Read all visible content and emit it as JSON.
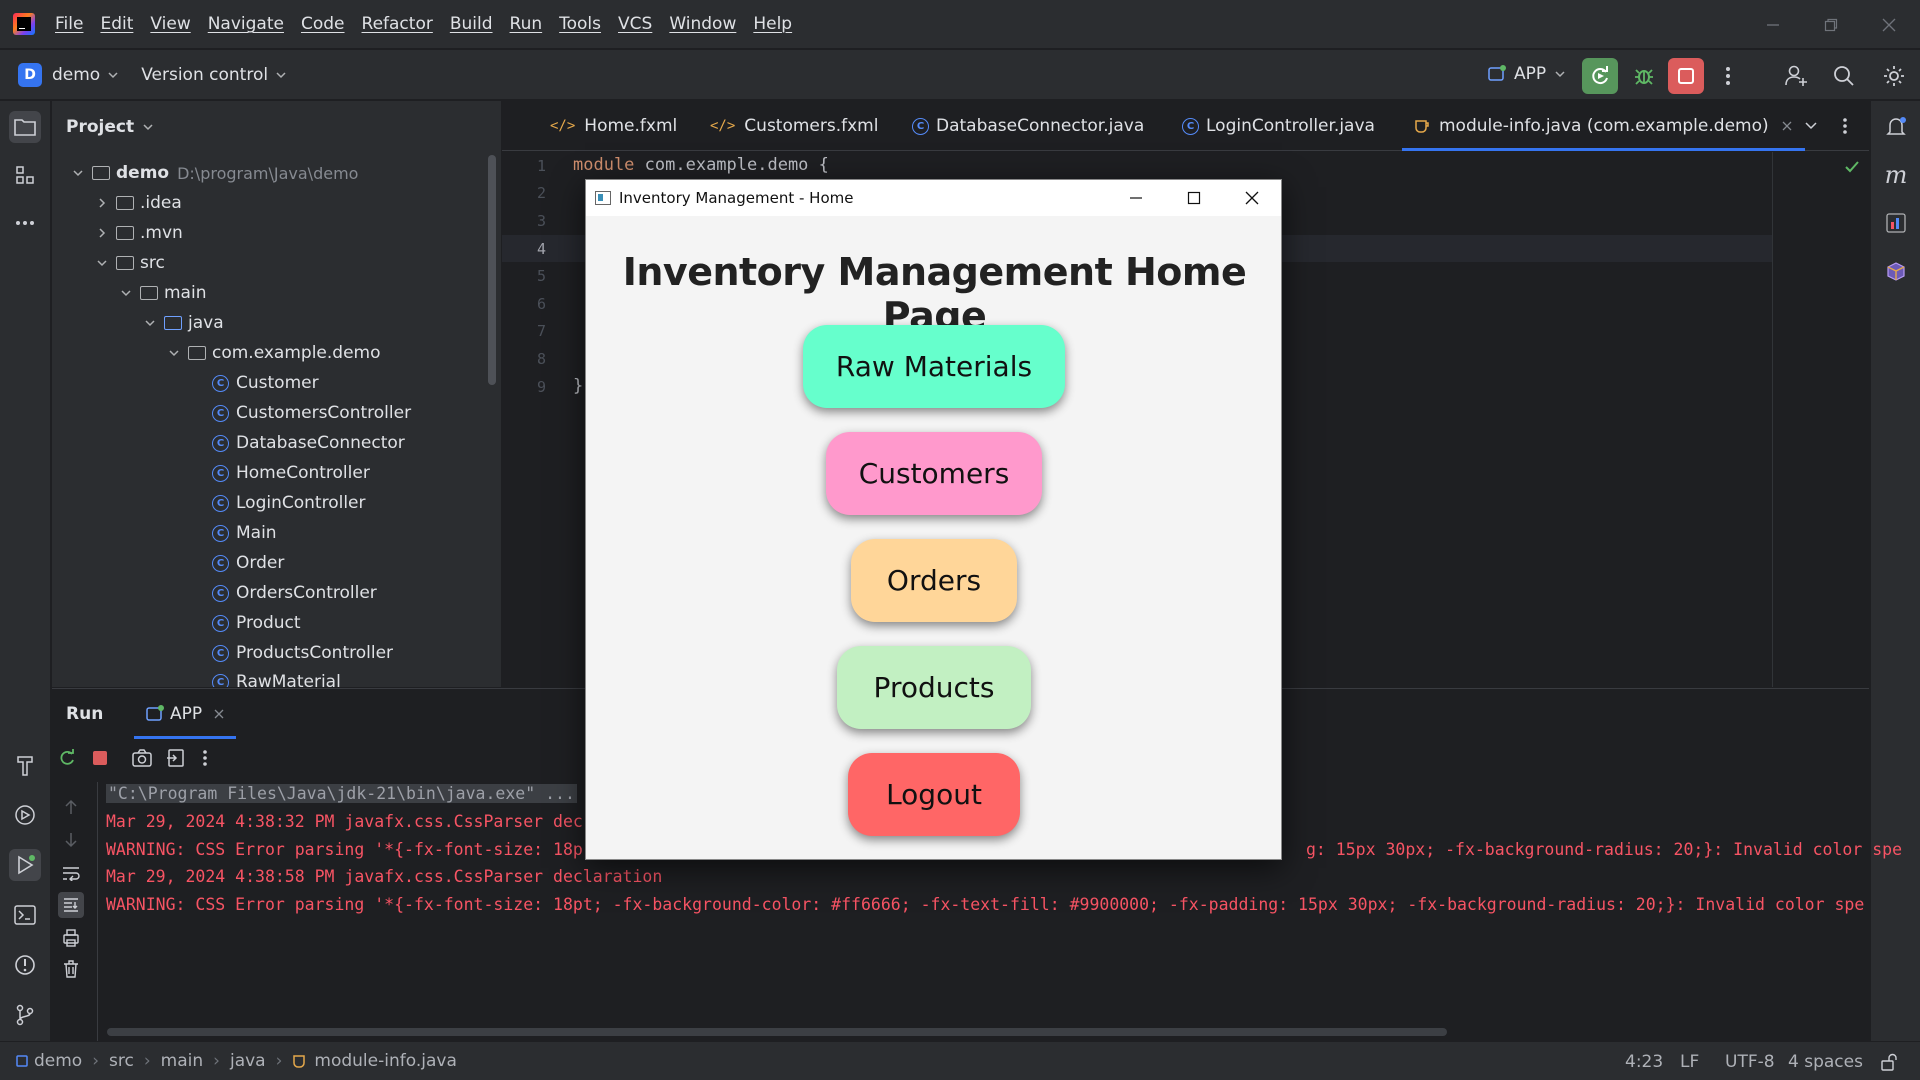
{
  "menu": [
    "File",
    "Edit",
    "View",
    "Navigate",
    "Code",
    "Refactor",
    "Build",
    "Run",
    "Tools",
    "VCS",
    "Window",
    "Help"
  ],
  "toolbar": {
    "project_badge": "D",
    "project_name": "demo",
    "version_control": "Version control",
    "run_config": "APP"
  },
  "project_panel": {
    "title": "Project",
    "root_name": "demo",
    "root_path": "D:\\program\\Java\\demo",
    "folders": [
      ".idea",
      ".mvn",
      "src",
      "main",
      "java",
      "com.example.demo"
    ],
    "classes": [
      "Customer",
      "CustomersController",
      "DatabaseConnector",
      "HomeController",
      "LoginController",
      "Main",
      "Order",
      "OrdersController",
      "Product",
      "ProductsController",
      "RawMaterial"
    ]
  },
  "editor": {
    "tabs": [
      "Home.fxml",
      "Customers.fxml",
      "DatabaseConnector.java",
      "LoginController.java",
      "module-info.java (com.example.demo)"
    ],
    "line_numbers": [
      "1",
      "2",
      "3",
      "4",
      "5",
      "6",
      "7",
      "8",
      "9"
    ],
    "code_line1_kw": "module",
    "code_line1_rest": " com.example.demo {",
    "code_line9": "}"
  },
  "run_panel": {
    "title": "Run",
    "tab": "APP",
    "lines": [
      "\"C:\\Program Files\\Java\\jdk-21\\bin\\java.exe\" ...",
      "Mar 29, 2024 4:38:32 PM javafx.css.CssParser dec",
      "WARNING: CSS Error parsing '*{-fx-font-size: 18p",
      "Mar 29, 2024 4:38:58 PM javafx.css.CssParser declaration",
      "WARNING: CSS Error parsing '*{-fx-font-size: 18pt; -fx-background-color: #ff6666; -fx-text-fill: #9900000; -fx-padding: 15px 30px; -fx-background-radius: 20;}: Invalid color spe"
    ],
    "line3_tail": "g: 15px 30px; -fx-background-radius: 20;}: Invalid color spe"
  },
  "status_bar": {
    "breadcrumbs": [
      "demo",
      "src",
      "main",
      "java",
      "module-info.java"
    ],
    "position": "4:23",
    "line_sep": "LF",
    "encoding": "UTF-8",
    "indent": "4 spaces"
  },
  "app_window": {
    "title": "Inventory Management - Home",
    "heading": "Inventory Management Home Page",
    "buttons": [
      {
        "label": "Raw Materials",
        "color": "#66ffcc"
      },
      {
        "label": "Customers",
        "color": "#ff99cc"
      },
      {
        "label": "Orders",
        "color": "#ffd699"
      },
      {
        "label": "Products",
        "color": "#c2f0c2"
      },
      {
        "label": "Logout",
        "color": "#ff6666"
      }
    ]
  },
  "colors": {
    "accent": "#3574f0",
    "error_text": "#f75464",
    "run_green": "#57965c",
    "stop_red": "#db5c5c"
  }
}
